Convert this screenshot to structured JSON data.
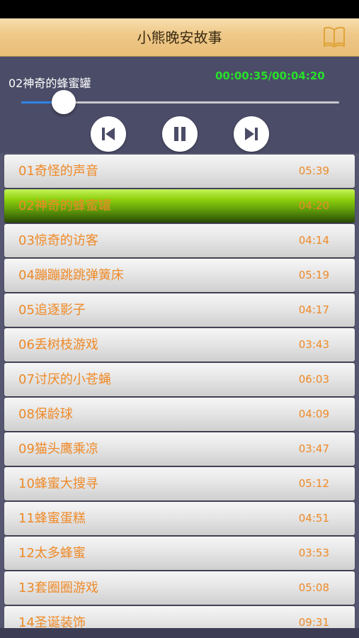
{
  "nav": {
    "title": "小熊晚安故事",
    "icon": "book-icon"
  },
  "player": {
    "track_title": "02神奇的蜂蜜罐",
    "time_display": "00:00:35/00:04:20",
    "progress_fraction": 0.134,
    "controls": {
      "prev_icon": "skip-previous-icon",
      "pause_icon": "pause-icon",
      "next_icon": "skip-next-icon"
    }
  },
  "colors": {
    "accent_text": "#ee8a28",
    "time_green": "#27e02a",
    "slider_fill": "#2f84e6",
    "active_row": "#8fd10d"
  },
  "tracks": [
    {
      "title": "01奇怪的声音",
      "duration": "05:39",
      "active": false
    },
    {
      "title": "02神奇的蜂蜜罐",
      "duration": "04:20",
      "active": true
    },
    {
      "title": "03惊奇的访客",
      "duration": "04:14",
      "active": false
    },
    {
      "title": "04蹦蹦跳跳弹簧床",
      "duration": "05:19",
      "active": false
    },
    {
      "title": "05追逐影子",
      "duration": "04:17",
      "active": false
    },
    {
      "title": "06丢树枝游戏",
      "duration": "03:43",
      "active": false
    },
    {
      "title": "07讨厌的小苍蝇",
      "duration": "06:03",
      "active": false
    },
    {
      "title": "08保龄球",
      "duration": "04:09",
      "active": false
    },
    {
      "title": "09猫头鹰乘凉",
      "duration": "03:47",
      "active": false
    },
    {
      "title": "10蜂蜜大搜寻",
      "duration": "05:12",
      "active": false
    },
    {
      "title": "11蜂蜜蛋糕",
      "duration": "04:51",
      "active": false
    },
    {
      "title": "12太多蜂蜜",
      "duration": "03:53",
      "active": false
    },
    {
      "title": "13套圈圈游戏",
      "duration": "05:08",
      "active": false
    },
    {
      "title": "14圣诞装饰",
      "duration": "09:31",
      "active": false
    }
  ]
}
